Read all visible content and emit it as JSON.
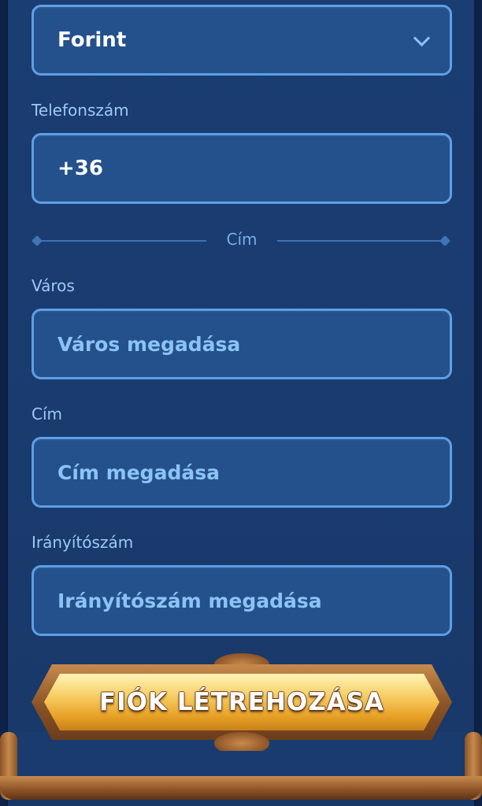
{
  "currency": {
    "selected": "Forint"
  },
  "phone": {
    "label": "Telefonszám",
    "value": "+36"
  },
  "section": {
    "title": "Cím"
  },
  "city": {
    "label": "Város",
    "placeholder": "Város megadása"
  },
  "address": {
    "label": "Cím",
    "placeholder": "Cím megadása"
  },
  "zip": {
    "label": "Irányítószám",
    "placeholder": "Irányítószám megadása"
  },
  "submit": {
    "label": "FIÓK LÉTREHOZÁSA"
  },
  "colors": {
    "field_border": "#5e9fe6",
    "field_bg": "#24518c",
    "panel_bg": "#1a3d72",
    "button_gold": "#f7cd63",
    "frame_bronze": "#8a5227"
  }
}
